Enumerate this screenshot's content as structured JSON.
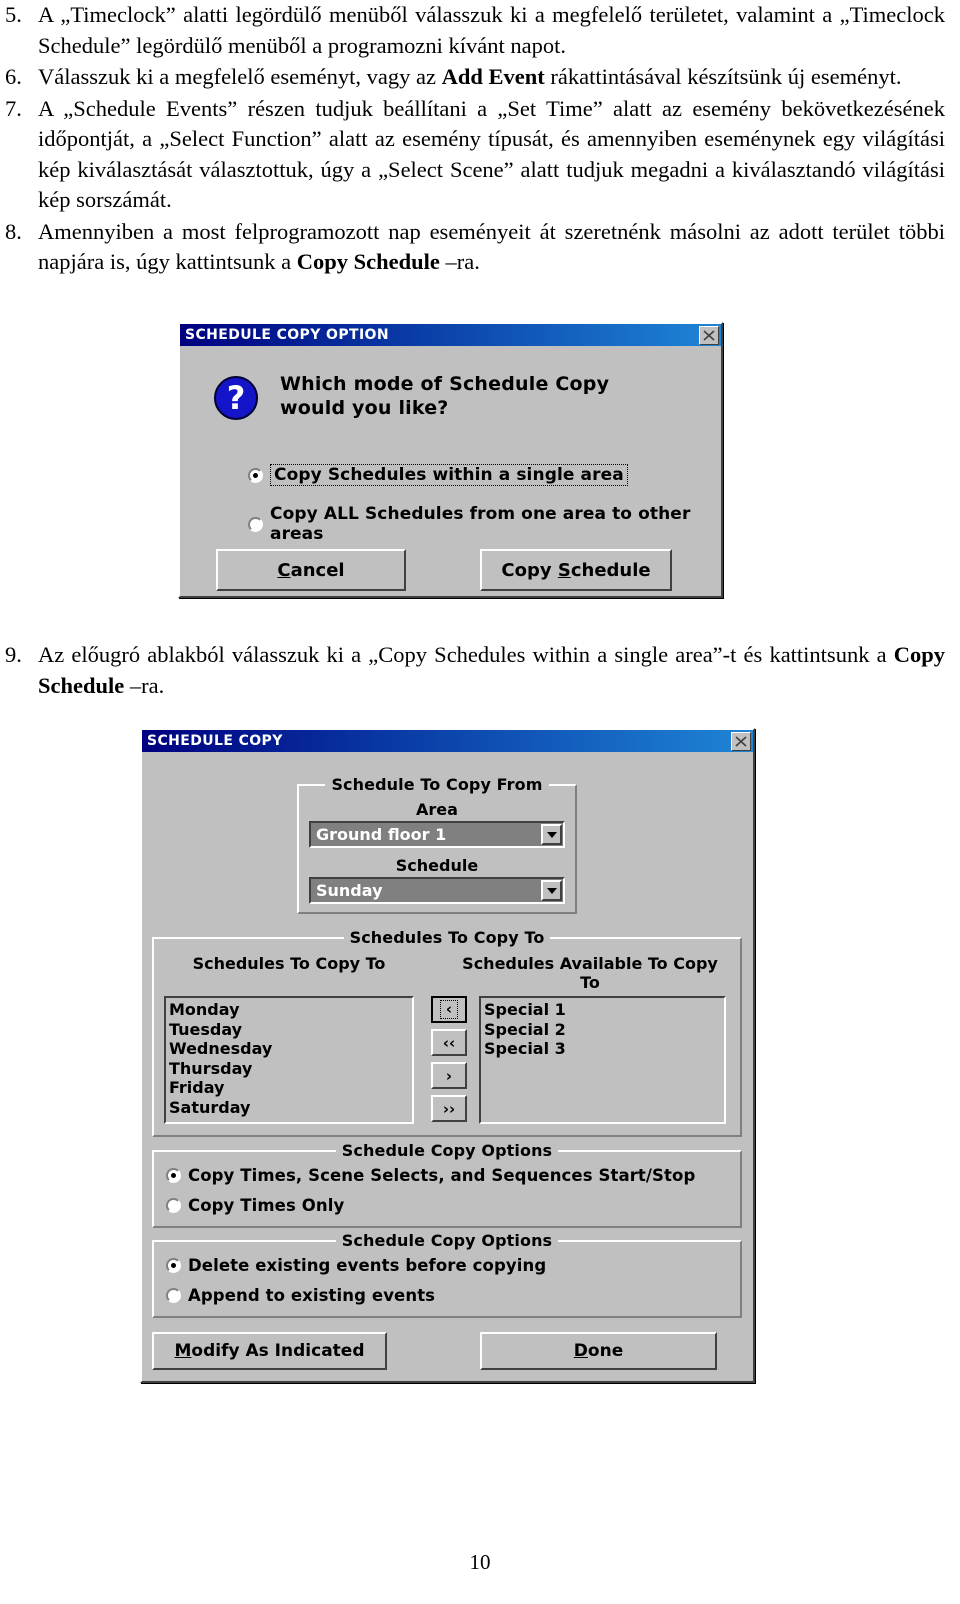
{
  "document": {
    "page_number": "10",
    "list_items": [
      {
        "number": "5.",
        "segments": [
          {
            "t": "A „Timeclock” alatti legördülő menüből válasszuk ki a megfelelő területet, valamint a „Timeclock Schedule” legördülő menüből a programozni kívánt napot.",
            "b": false
          }
        ]
      },
      {
        "number": "6.",
        "segments": [
          {
            "t": "Válasszuk ki a megfelelő eseményt, vagy az ",
            "b": false
          },
          {
            "t": "Add Event",
            "b": true
          },
          {
            "t": " rákattintásával készítsünk új eseményt.",
            "b": false
          }
        ]
      },
      {
        "number": "7.",
        "segments": [
          {
            "t": "A „Schedule Events” részen tudjuk beállítani a „Set Time” alatt az esemény bekövetkezésének időpontját, a „Select Function” alatt az esemény típusát, és amennyiben eseménynek egy világítási kép kiválasztását választottuk, úgy a „Select Scene” alatt tudjuk megadni a kiválasztandó világítási kép sorszámát.",
            "b": false
          }
        ]
      },
      {
        "number": "8.",
        "segments": [
          {
            "t": "Amennyiben a most felprogramozott nap eseményeit át szeretnénk másolni az adott terület többi napjára is, úgy kattintsunk a ",
            "b": false
          },
          {
            "t": "Copy Schedule",
            "b": true
          },
          {
            "t": " –ra.",
            "b": false
          }
        ]
      },
      {
        "number": "9.",
        "segments": [
          {
            "t": "Az előugró ablakból válasszuk ki a „Copy Schedules within a single area”-t és kattintsunk a ",
            "b": false
          },
          {
            "t": "Copy Schedule",
            "b": true
          },
          {
            "t": " –ra.",
            "b": false
          }
        ]
      }
    ]
  },
  "dialog_copy_option": {
    "title": "SCHEDULE COPY OPTION",
    "close_icon": "close-x-icon",
    "icon": "question-mark-icon",
    "icon_glyph": "?",
    "prompt_line1": "Which mode of Schedule Copy",
    "prompt_line2": "would you like?",
    "radios": [
      {
        "label": "Copy Schedules within a single area",
        "selected": true,
        "focused": true
      },
      {
        "label": "Copy ALL Schedules from one area to other areas",
        "selected": false,
        "focused": false
      }
    ],
    "buttons": {
      "cancel": {
        "accel": "C",
        "rest": "ancel"
      },
      "copy_schedule": {
        "pre": "Copy ",
        "accel": "S",
        "rest": "chedule"
      }
    }
  },
  "dialog_schedule_copy": {
    "title": "SCHEDULE COPY",
    "close_icon": "close-x-icon",
    "group_from": {
      "title": "Schedule To Copy From",
      "area_label": "Area",
      "area_value": "Ground floor 1",
      "schedule_label": "Schedule",
      "schedule_value": "Sunday"
    },
    "group_to": {
      "title": "Schedules To Copy To",
      "left_header": "Schedules To Copy To",
      "right_header_line1": "Schedules Available To Copy",
      "right_header_line2": "To",
      "left_items": [
        "Monday",
        "Tuesday",
        "Wednesday",
        "Thursday",
        "Friday",
        "Saturday"
      ],
      "right_items": [
        "Special 1",
        "Special 2",
        "Special 3"
      ],
      "transfer_buttons": [
        {
          "label": "‹",
          "name": "move-one-left-button",
          "focused": true
        },
        {
          "label": "‹‹",
          "name": "move-all-left-button",
          "focused": false
        },
        {
          "label": "›",
          "name": "move-one-right-button",
          "focused": false
        },
        {
          "label": "››",
          "name": "move-all-right-button",
          "focused": false
        }
      ]
    },
    "group_options_1": {
      "title": "Schedule Copy Options",
      "radios": [
        {
          "label": "Copy Times, Scene Selects, and Sequences Start/Stop",
          "selected": true
        },
        {
          "label": "Copy Times Only",
          "selected": false
        }
      ]
    },
    "group_options_2": {
      "title": "Schedule Copy Options",
      "radios": [
        {
          "label": "Delete existing events before copying",
          "selected": true
        },
        {
          "label": "Append to existing events",
          "selected": false
        }
      ]
    },
    "buttons": {
      "modify": {
        "accel": "M",
        "rest": "odify As Indicated"
      },
      "done": {
        "accel": "D",
        "rest": "one"
      }
    }
  },
  "colors": {
    "titlebar_start": "#000080",
    "titlebar_end": "#1f85d6",
    "dialog_face": "#c0c0c0",
    "question_icon": "#1414c8",
    "combo_face": "#808080"
  }
}
